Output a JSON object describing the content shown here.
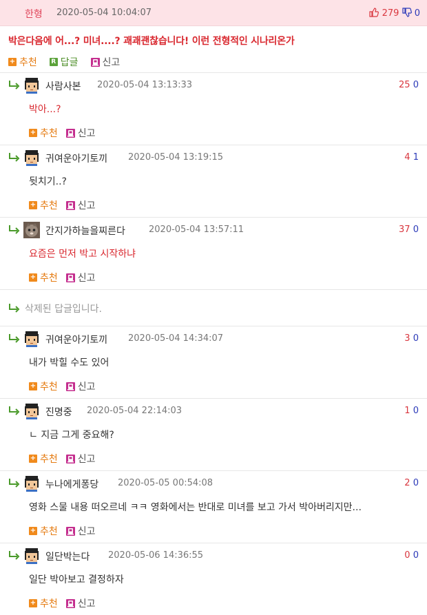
{
  "root": {
    "author": "한형",
    "date": "2020-05-04 10:04:07",
    "up": "279",
    "down": "0",
    "body": "박은다음에 어...? 미녀....? 괘괘괜찮습니다! 이런 전형적인 시나리온가",
    "actions": {
      "recommend": "추천",
      "reply": "답글",
      "report": "신고"
    }
  },
  "replies": [
    {
      "author": "사람사본",
      "date": "2020-05-04 13:13:33",
      "up": "25",
      "down": "0",
      "body": "박아...?",
      "red": true,
      "avatar": "pixel-person"
    },
    {
      "author": "귀여운아기토끼",
      "date": "2020-05-04 13:19:15",
      "up": "4",
      "down": "1",
      "body": "뒷치기..?",
      "red": false,
      "avatar": "pixel-person"
    },
    {
      "author": "간지가하늘을찌른다",
      "date": "2020-05-04 13:57:11",
      "up": "37",
      "down": "0",
      "body": "요즘은 먼저 박고 시작하냐",
      "red": true,
      "avatar": "cat-photo"
    },
    {
      "deleted": true,
      "body": "삭제된 답글입니다."
    },
    {
      "author": "귀여운아기토끼",
      "date": "2020-05-04 14:34:07",
      "up": "3",
      "down": "0",
      "body": "내가 박힐 수도 있어",
      "red": false,
      "avatar": "pixel-person"
    },
    {
      "author": "진명중",
      "date": "2020-05-04 22:14:03",
      "up": "1",
      "down": "0",
      "body": "ㄴ 지금 그게 중요해?",
      "red": false,
      "avatar": "pixel-person"
    },
    {
      "author": "누나에게퐁당",
      "date": "2020-05-05 00:54:08",
      "up": "2",
      "down": "0",
      "body": "영화 스물 내용 떠오르네 ㅋㅋ 영화에서는 반대로 미녀를 보고 가서 박아버리지만...",
      "red": false,
      "avatar": "pixel-person"
    },
    {
      "author": "일단박는다",
      "date": "2020-05-06 14:36:55",
      "up": "0",
      "down": "0",
      "body": "일단 박아보고 결정하자",
      "red": false,
      "avatar": "pixel-person"
    }
  ],
  "labels": {
    "recommend": "추천",
    "report": "신고"
  },
  "colors": {
    "accent_red": "#d9282f",
    "header_bg": "#fde3e7",
    "down_blue": "#2b39b8",
    "recommend_orange": "#e57b11"
  }
}
